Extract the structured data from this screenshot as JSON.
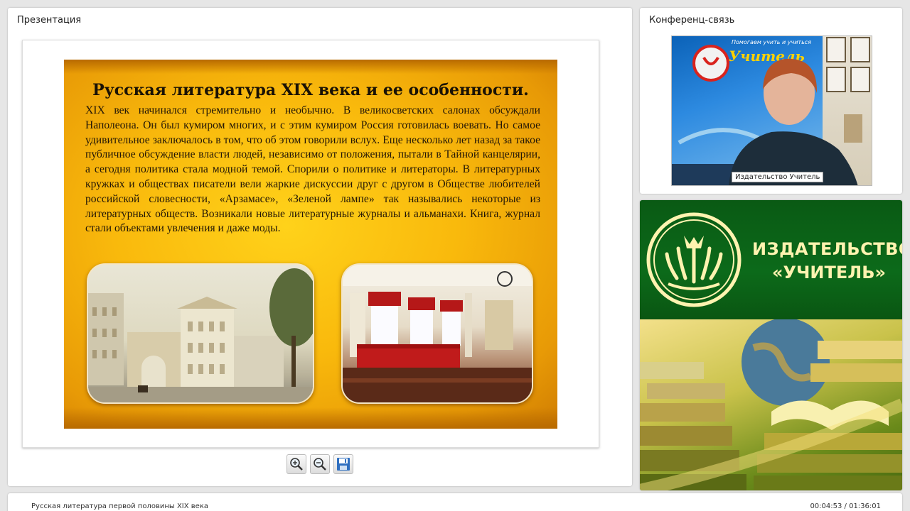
{
  "presentation": {
    "title": "Презентация",
    "slide": {
      "title": "Русская литература XIX века и ее особенности.",
      "text": "XIX век начинался стремительно и необычно. В великосветских салонах обсуждали Наполеона. Он был кумиром многих, и с этим кумиром Россия готовилась воевать. Но самое удивительное заключалось в том, что об этом говорили вслух. Еще несколько лет назад за такое публичное обсуждение власти людей, независимо от положения, пытали в Тайной канцелярии, а сегодня политика стала модной темой. Спорили о политике и литераторы. В литературных кружках и обществах писатели вели жаркие дискуссии друг с другом в Обществе любителей российской словесности, «Арзамасе», «Зеленой лампе» так назывались некоторые из литературных обществ. Возникали новые литературные журналы и альманахи. Книга, журнал стали объектами увлечения и даже моды."
    },
    "toolbar": {
      "zoom_in_icon": "zoom-in-icon",
      "zoom_out_icon": "zoom-out-icon",
      "save_icon": "floppy-disk-icon"
    }
  },
  "conference": {
    "title": "Конференц-связь",
    "banner_text": "Помогаем учить и учиться",
    "banner_brand": "Учитель",
    "caption": "Издательство Учитель"
  },
  "ad": {
    "brand_line1": "ИЗДАТЕЛЬСТВО",
    "brand_line2": "«УЧИТЕЛЬ»",
    "logo_icon": "book-logo-icon"
  },
  "status": {
    "course_title": "Русская литература первой половины XIX века",
    "time": "00:04:53 / 01:36:01"
  },
  "colors": {
    "slide_bg": "#f9b90c",
    "ad_green": "#0c6a1a",
    "brand_yellow": "#fff3b0"
  }
}
